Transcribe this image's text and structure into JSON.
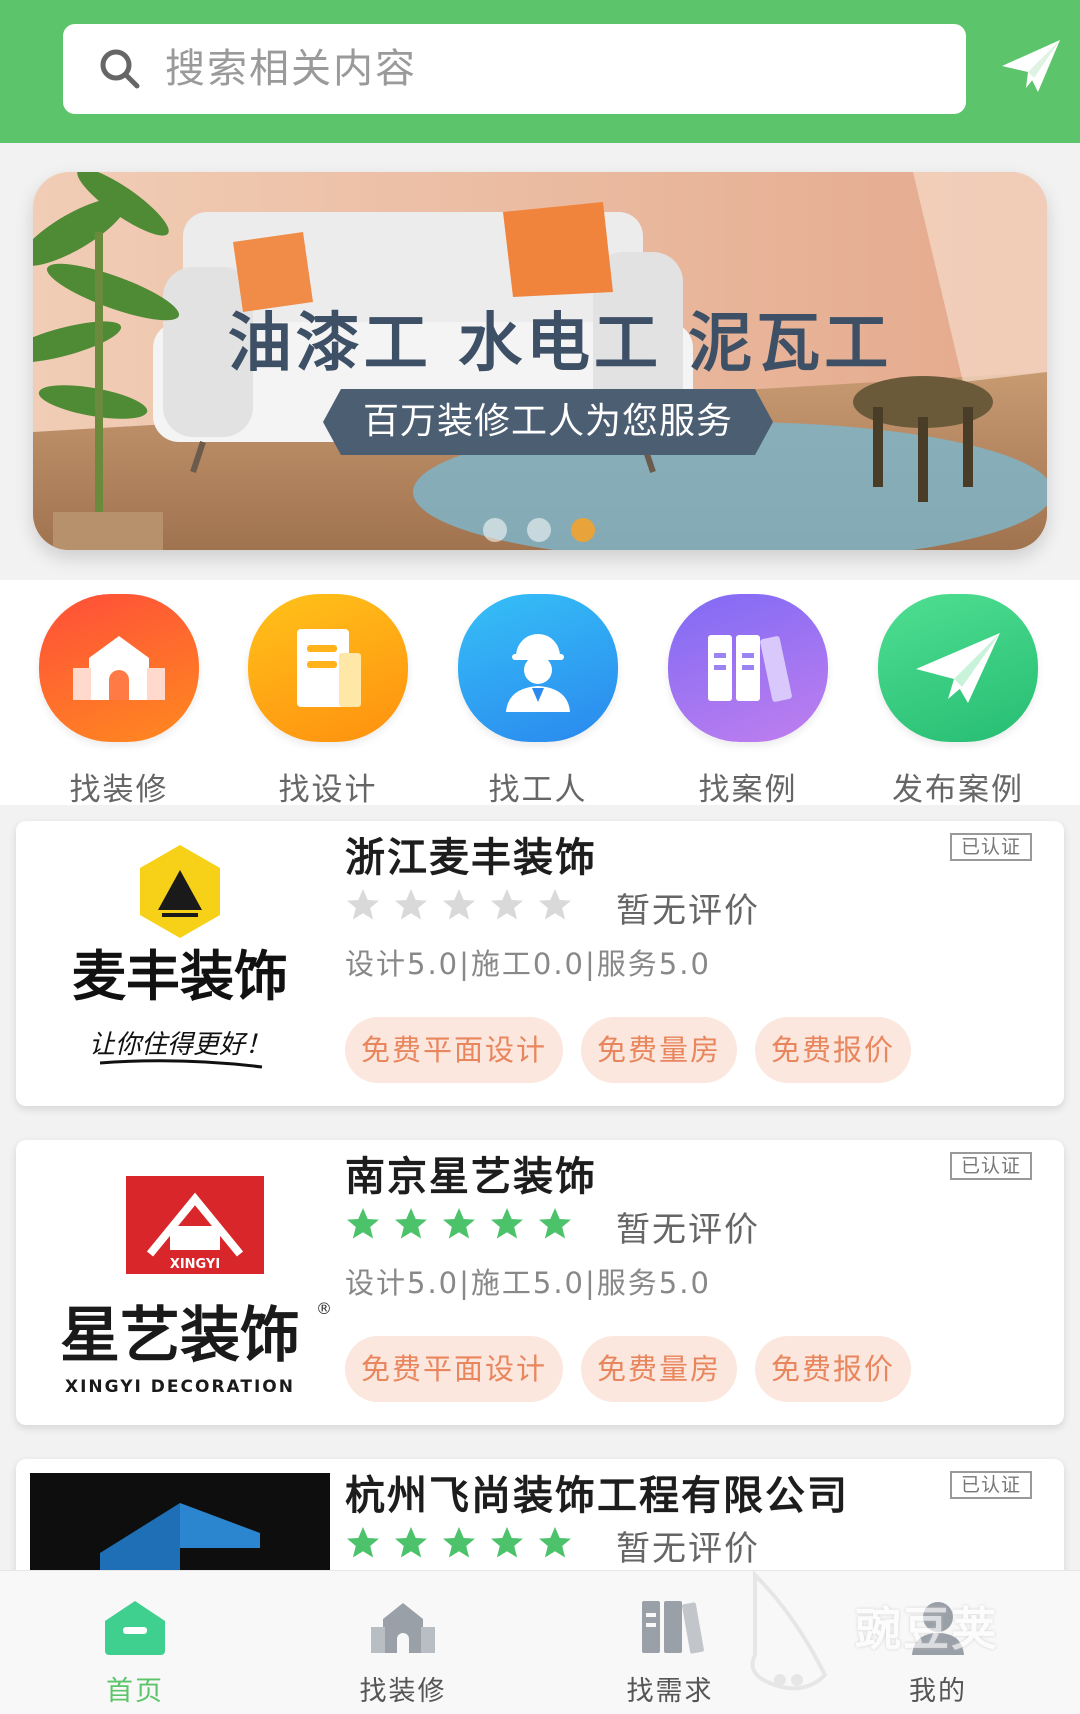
{
  "search": {
    "placeholder": "搜索相关内容"
  },
  "banner": {
    "headline": "油漆工 水电工 泥瓦工",
    "tagline": "百万装修工人为您服务",
    "dots": [
      false,
      false,
      true
    ]
  },
  "categories": [
    {
      "label": "找装修",
      "icon": "house-icon",
      "color_from": "#ff5a3c",
      "color_to": "#ff8a1f"
    },
    {
      "label": "找设计",
      "icon": "document-icon",
      "color_from": "#ffb21a",
      "color_to": "#ff8f0f"
    },
    {
      "label": "找工人",
      "icon": "worker-icon",
      "color_from": "#2fb3f5",
      "color_to": "#2b8ff0"
    },
    {
      "label": "找案例",
      "icon": "books-icon",
      "color_from": "#8a6cf5",
      "color_to": "#b07cf0"
    },
    {
      "label": "发布案例",
      "icon": "send-icon",
      "color_from": "#45d888",
      "color_to": "#27c076"
    }
  ],
  "companies": [
    {
      "name": "浙江麦丰装饰",
      "verified": "已认证",
      "stars": 0,
      "rating_text": "暂无评价",
      "scores": "设计5.0|施工0.0|服务5.0",
      "tags": [
        "免费平面设计",
        "免费量房",
        "免费报价"
      ],
      "logo_title": "麦丰装饰",
      "logo_slogan": "让你住得更好！"
    },
    {
      "name": "南京星艺装饰",
      "verified": "已认证",
      "stars": 5,
      "rating_text": "暂无评价",
      "scores": "设计5.0|施工5.0|服务5.0",
      "tags": [
        "免费平面设计",
        "免费量房",
        "免费报价"
      ],
      "logo_title": "星艺装饰",
      "logo_subtitle": "XINGYI DECORATION"
    },
    {
      "name": "杭州飞尚装饰工程有限公司",
      "verified": "已认证",
      "stars": 5,
      "rating_text": "暂无评价"
    }
  ],
  "nav": [
    {
      "label": "首页",
      "icon": "home-icon",
      "active": true
    },
    {
      "label": "找装修",
      "icon": "house-icon",
      "active": false
    },
    {
      "label": "找需求",
      "icon": "books-icon",
      "active": false
    },
    {
      "label": "我的",
      "icon": "user-icon",
      "active": false
    }
  ],
  "watermark": "豌豆荚",
  "colors": {
    "brand": "#5cc46a",
    "tag_bg": "#fbe7de",
    "tag_text": "#e8865e",
    "star_on": "#4cc26a",
    "star_off": "#d9d9d9"
  }
}
